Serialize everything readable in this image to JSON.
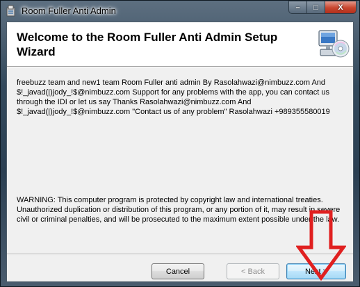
{
  "window": {
    "title": "Room Fuller Anti Admin"
  },
  "header": {
    "title": "Welcome to the Room Fuller Anti Admin Setup Wizard"
  },
  "body": {
    "description": "freebuzz team and new1 team  Room Fuller  anti admin By Rasolahwazi@nimbuzz.com And $!_javad(|)jody_!$@nimbuzz.com Support for any problems with the app, you can contact us through the IDI or let us say Thanks Rasolahwazi@nimbuzz.com And $!_javad(|)jody_!$@nimbuzz.com \"Contact us of any problem\" Rasolahwazi +989355580019",
    "warning": "WARNING: This computer program is protected by copyright law and international treaties. Unauthorized duplication or distribution of this program, or any portion of it, may result in severe civil or criminal penalties, and will be prosecuted to the maximum extent possible under the law."
  },
  "buttons": {
    "cancel": "Cancel",
    "back": "< Back",
    "next": "Next >"
  },
  "caption_buttons": {
    "minimize": "–",
    "maximize": "□",
    "close": "X"
  },
  "colors": {
    "annotation_arrow": "#e02020",
    "next_button_border": "#3c7fb1"
  },
  "icons": {
    "app": "installer-package-icon",
    "header": "computer-cd-icon",
    "annotation": "red-down-arrow-icon"
  }
}
